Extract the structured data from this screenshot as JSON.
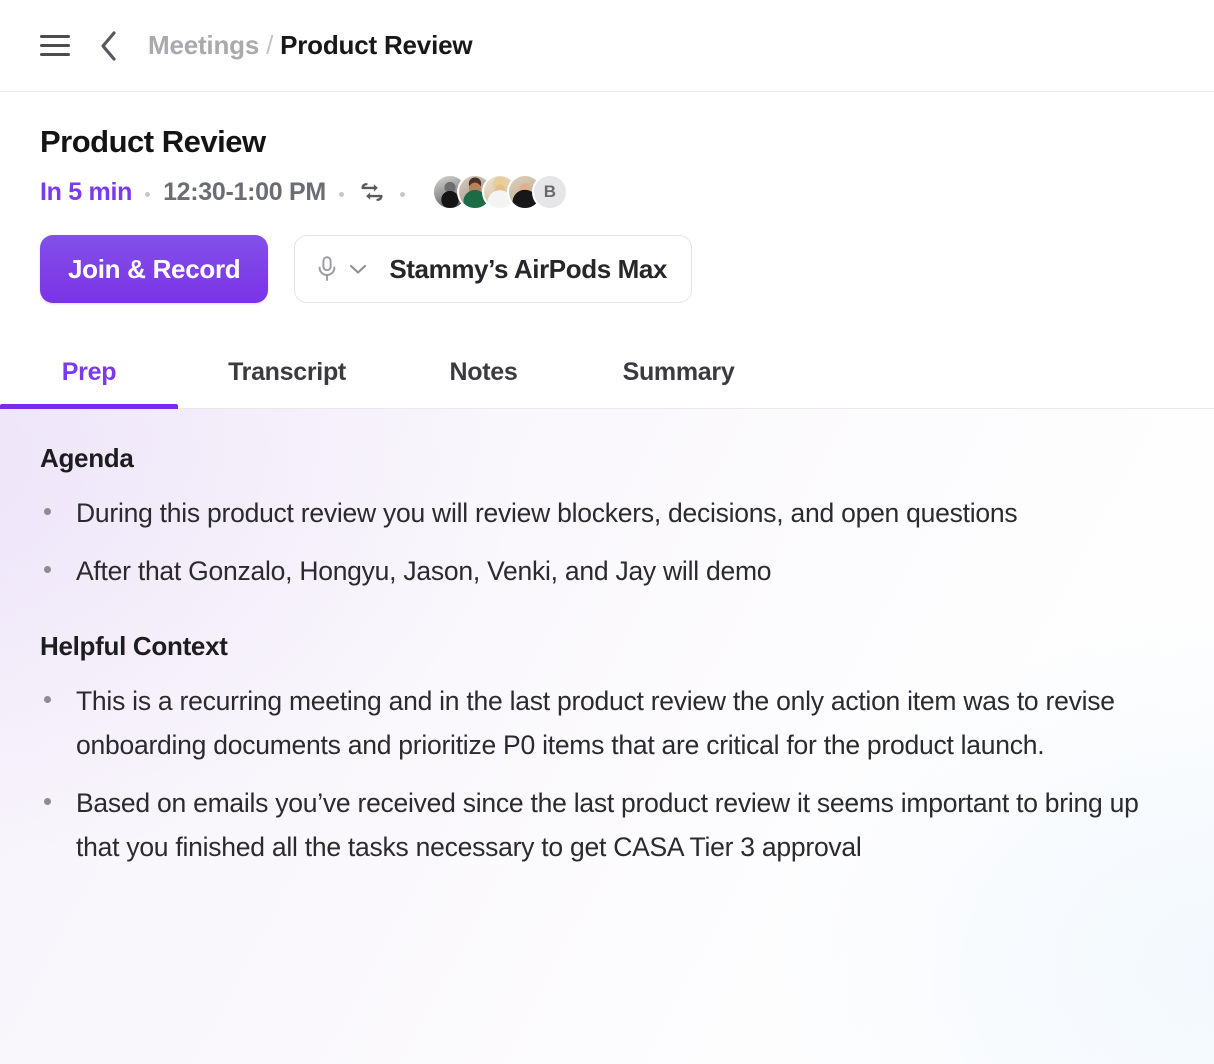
{
  "topbar": {
    "menu_icon": "hamburger-menu-icon",
    "back_icon": "chevron-left-icon",
    "breadcrumb": {
      "parent": "Meetings",
      "separator": "/",
      "current": "Product Review"
    }
  },
  "meeting": {
    "title": "Product Review",
    "countdown": "In 5 min",
    "time_range": "12:30-1:00 PM",
    "recurring_icon": "repeat-icon",
    "attendees": [
      {
        "name": "",
        "type": "photo",
        "style": "av-a"
      },
      {
        "name": "",
        "type": "photo",
        "style": "av-b"
      },
      {
        "name": "",
        "type": "photo",
        "style": "av-c"
      },
      {
        "name": "",
        "type": "photo",
        "style": "av-d"
      },
      {
        "name": "B",
        "type": "initial",
        "style": "initial"
      }
    ]
  },
  "actions": {
    "join_label": "Join & Record",
    "mic_icon": "microphone-icon",
    "mic_chevron_icon": "chevron-down-icon",
    "mic_device": "Stammy’s AirPods Max"
  },
  "tabs": [
    {
      "label": "Prep",
      "active": true
    },
    {
      "label": "Transcript",
      "active": false
    },
    {
      "label": "Notes",
      "active": false
    },
    {
      "label": "Summary",
      "active": false
    }
  ],
  "prep": {
    "sections": [
      {
        "heading": "Agenda",
        "bullets": [
          "During this product review you will review blockers, decisions, and open questions",
          "After that Gonzalo, Hongyu, Jason, Venki, and Jay will demo"
        ]
      },
      {
        "heading": "Helpful Context",
        "bullets": [
          "This is a recurring meeting and in the last product review the only action item was to revise onboarding documents and prioritize P0 items that are critical for the product launch.",
          "Based on emails you’ve received since the last product review it seems important to bring up that you finished all the tasks necessary to get CASA Tier 3 approval"
        ]
      }
    ]
  },
  "colors": {
    "accent_purple": "#7c3aed",
    "button_gradient_top": "#8350e8",
    "button_gradient_bottom": "#7a33e6",
    "tab_underline": "#7c2ae8",
    "muted_text": "#6c6c74",
    "breadcrumb_muted": "#a9a9ae"
  }
}
